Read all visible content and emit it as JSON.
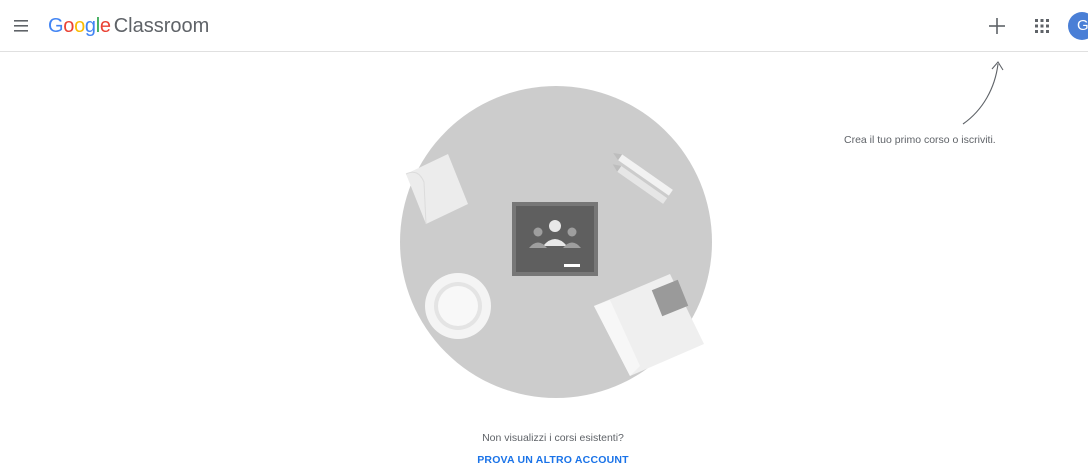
{
  "header": {
    "logo_letters": [
      {
        "char": "G",
        "color": "#4285f4"
      },
      {
        "char": "o",
        "color": "#ea4335"
      },
      {
        "char": "o",
        "color": "#fbbc05"
      },
      {
        "char": "g",
        "color": "#4285f4"
      },
      {
        "char": "l",
        "color": "#34a853"
      },
      {
        "char": "e",
        "color": "#ea4335"
      }
    ],
    "product_name": "Classroom",
    "menu_icon": "hamburger-menu-icon",
    "plus_icon": "plus-icon",
    "apps_icon": "apps-grid-icon",
    "avatar_initial": "G",
    "avatar_color": "#4a7fd6"
  },
  "hint": {
    "text": "Crea il tuo primo corso o iscriviti."
  },
  "empty_state": {
    "message": "Non visualizzi i corsi esistenti?",
    "action_label": "PROVA UN ALTRO ACCOUNT",
    "action_color": "#1a73e8"
  },
  "colors": {
    "illustration_circle": "#cccccc",
    "board": "#5f6368"
  }
}
